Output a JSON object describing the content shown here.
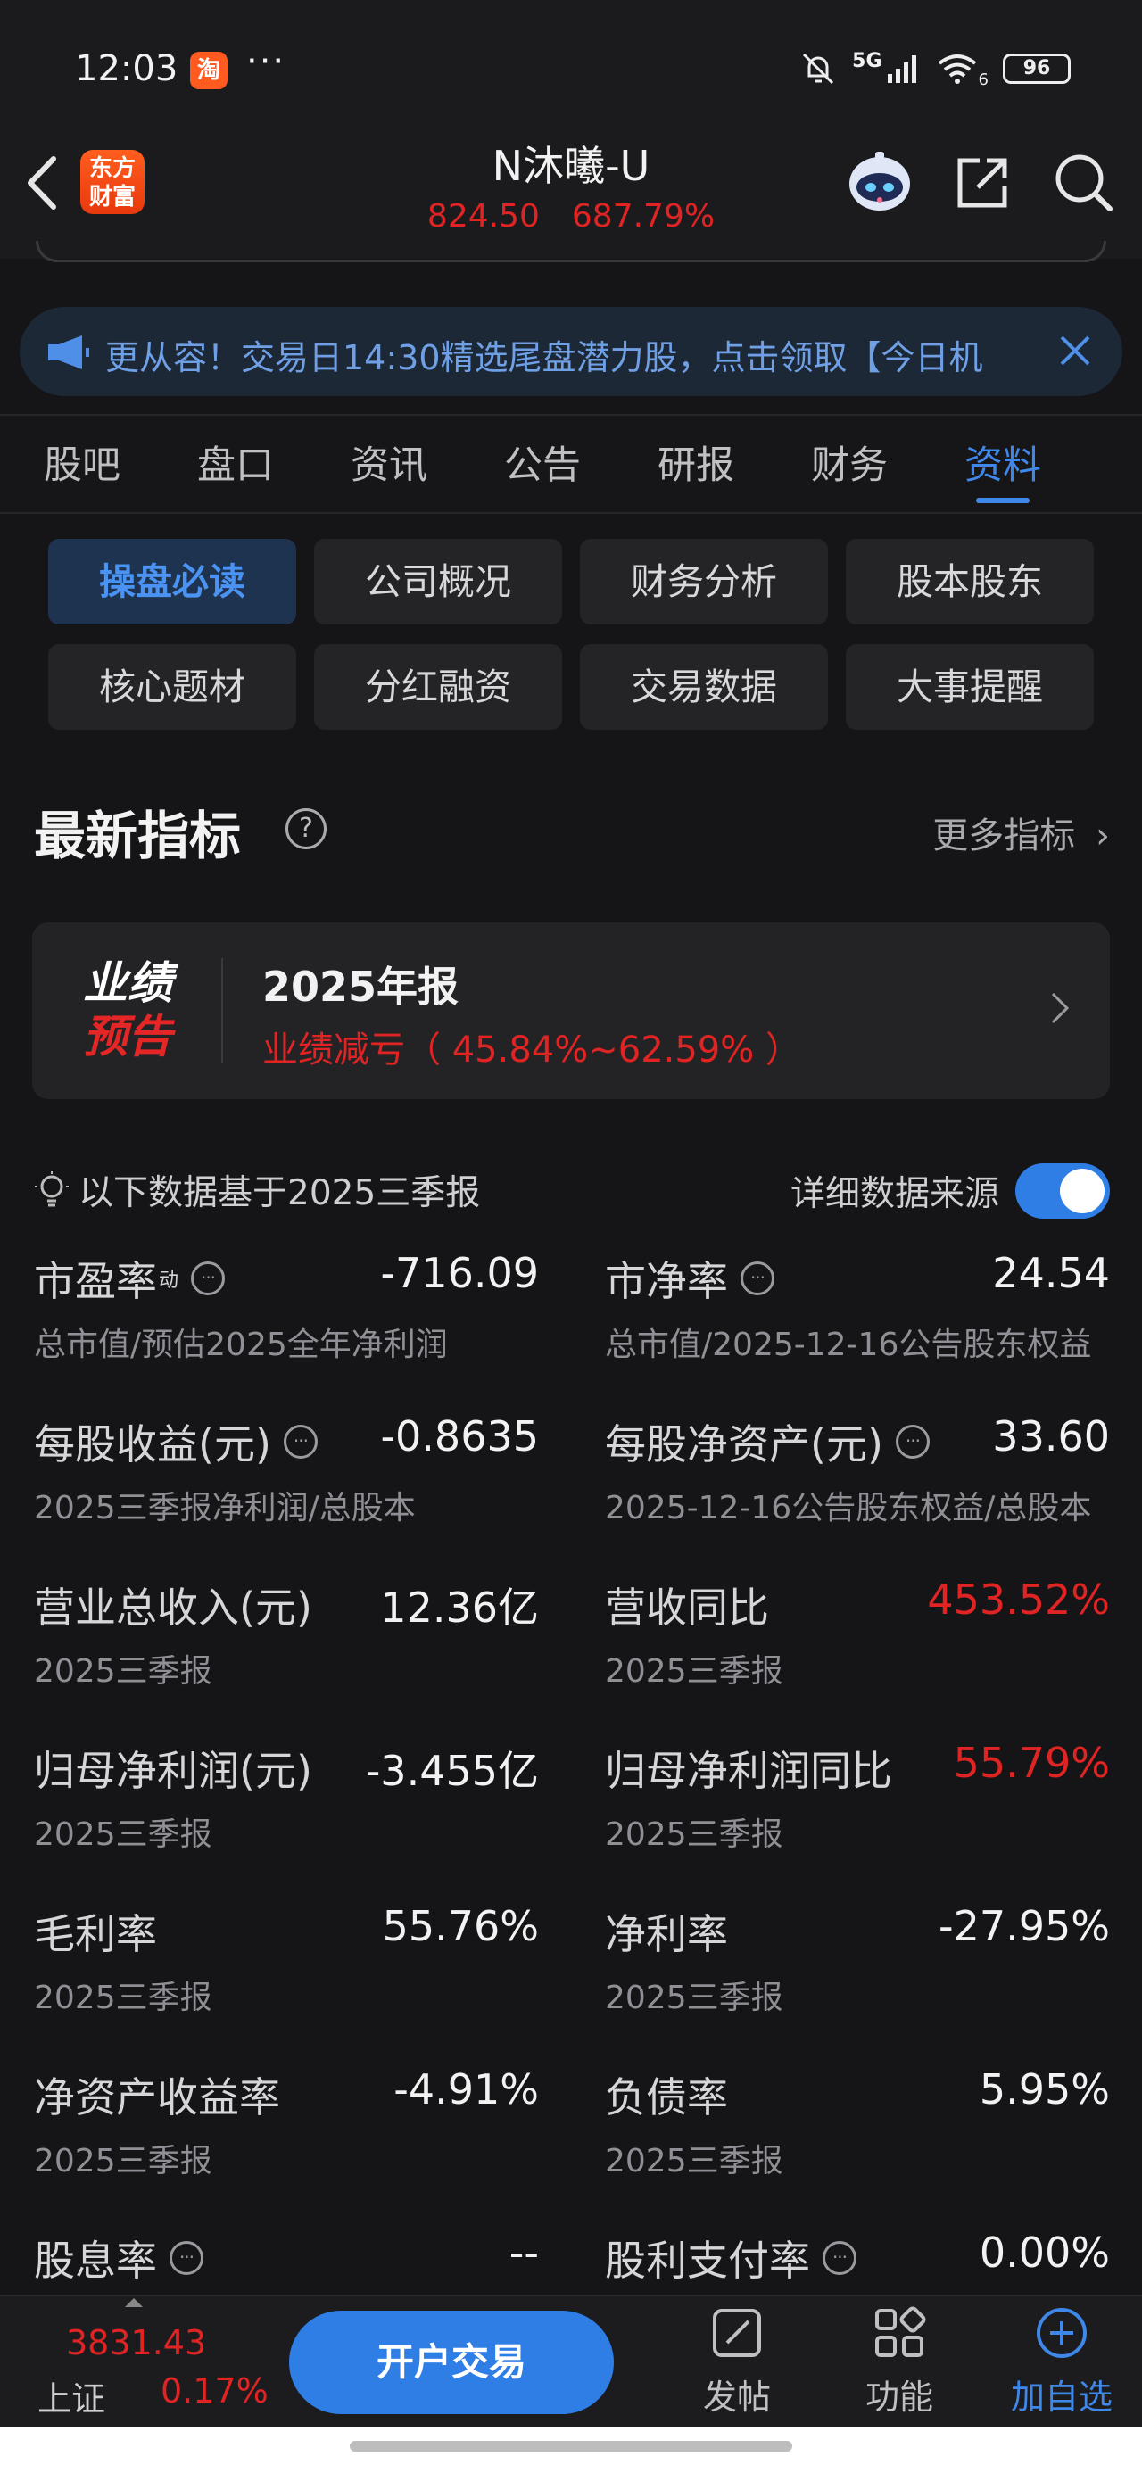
{
  "status_bar": {
    "time": "12:03",
    "app_badge": "淘",
    "more": "···",
    "network": "5G",
    "wifi_sub": "6",
    "battery": "96"
  },
  "header": {
    "brand": [
      "东方",
      "财富"
    ],
    "stock_name": "N沐曦-U",
    "price": "824.50",
    "change_pct": "687.79%"
  },
  "notice": {
    "text": "更从容！交易日14:30精选尾盘潜力股，点击领取【今日机"
  },
  "tabs": [
    "股吧",
    "盘口",
    "资讯",
    "公告",
    "研报",
    "财务",
    "资料"
  ],
  "active_tab": "资料",
  "sub_tabs": [
    "操盘必读",
    "公司概况",
    "财务分析",
    "股本股东",
    "核心题材",
    "分红融资",
    "交易数据",
    "大事提醒"
  ],
  "indicators": {
    "title": "最新指标",
    "help": "?",
    "more": "更多指标",
    "forecast": {
      "badge_line1": "业绩",
      "badge_line2": "预告",
      "title": "2025年报",
      "summary": "业绩减亏（ 45.84%~62.59% ）"
    },
    "basis": "以下数据基于2025三季报",
    "source_label": "详细数据来源",
    "source_toggle_on": true,
    "metrics": [
      {
        "label": "市盈率",
        "sup": "动",
        "info": true,
        "value": "-716.09",
        "desc": "总市值/预估2025全年净利润"
      },
      {
        "label": "市净率",
        "sup": "",
        "info": true,
        "value": "24.54",
        "desc": "总市值/2025-12-16公告股东权益"
      },
      {
        "label": "每股收益(元)",
        "sup": "",
        "info": true,
        "value": "-0.8635",
        "desc": "2025三季报净利润/总股本"
      },
      {
        "label": "每股净资产(元)",
        "sup": "",
        "info": true,
        "value": "33.60",
        "desc": "2025-12-16公告股东权益/总股本"
      },
      {
        "label": "营业总收入(元)",
        "sup": "",
        "info": false,
        "value": "12.36亿",
        "desc": "2025三季报"
      },
      {
        "label": "营收同比",
        "sup": "",
        "info": false,
        "value": "453.52%",
        "desc": "2025三季报",
        "red": true
      },
      {
        "label": "归母净利润(元)",
        "sup": "",
        "info": false,
        "value": "-3.455亿",
        "desc": "2025三季报"
      },
      {
        "label": "归母净利润同比",
        "sup": "",
        "info": false,
        "value": "55.79%",
        "desc": "2025三季报",
        "red": true
      },
      {
        "label": "毛利率",
        "sup": "",
        "info": false,
        "value": "55.76%",
        "desc": "2025三季报"
      },
      {
        "label": "净利率",
        "sup": "",
        "info": false,
        "value": "-27.95%",
        "desc": "2025三季报"
      },
      {
        "label": "净资产收益率",
        "sup": "",
        "info": false,
        "value": "-4.91%",
        "desc": "2025三季报"
      },
      {
        "label": "负债率",
        "sup": "",
        "info": false,
        "value": "5.95%",
        "desc": "2025三季报"
      },
      {
        "label": "股息率",
        "sup": "",
        "info": true,
        "value": "--",
        "desc": ""
      },
      {
        "label": "股利支付率",
        "sup": "",
        "info": true,
        "value": "0.00%",
        "desc": ""
      }
    ]
  },
  "bottom_bar": {
    "index_value": "3831.43",
    "index_name": "上证",
    "index_change": "0.17%",
    "trade_button": "开户交易",
    "nav": [
      {
        "label": "发帖",
        "icon": "edit-icon"
      },
      {
        "label": "功能",
        "icon": "grid-icon"
      },
      {
        "label": "加自选",
        "icon": "add-circle-icon"
      }
    ]
  },
  "colors": {
    "accent": "#2f7ee6",
    "up_red": "#e02424",
    "background": "#151517"
  }
}
